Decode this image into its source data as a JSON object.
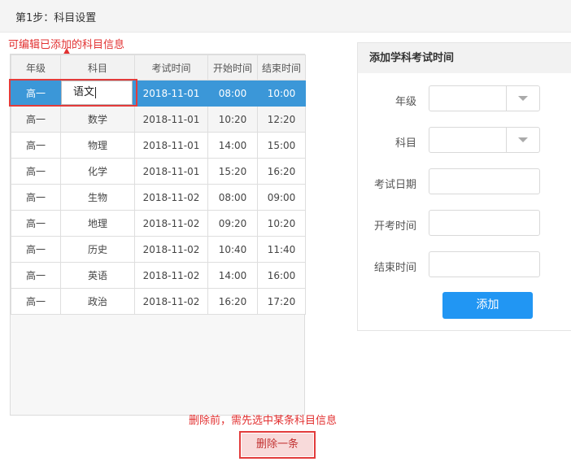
{
  "header": {
    "title": "第1步：科目设置"
  },
  "annotations": {
    "edit_hint": "可编辑已添加的科目信息",
    "delete_hint": "删除前，需先选中某条科目信息"
  },
  "table": {
    "columns": [
      "年级",
      "科目",
      "考试时间",
      "开始时间",
      "结束时间"
    ],
    "rows": [
      [
        "高一",
        "语文",
        "2018-11-01",
        "08:00",
        "10:00"
      ],
      [
        "高一",
        "数学",
        "2018-11-01",
        "10:20",
        "12:20"
      ],
      [
        "高一",
        "物理",
        "2018-11-01",
        "14:00",
        "15:00"
      ],
      [
        "高一",
        "化学",
        "2018-11-01",
        "15:20",
        "16:20"
      ],
      [
        "高一",
        "生物",
        "2018-11-02",
        "08:00",
        "09:00"
      ],
      [
        "高一",
        "地理",
        "2018-11-02",
        "09:20",
        "10:20"
      ],
      [
        "高一",
        "历史",
        "2018-11-02",
        "10:40",
        "11:40"
      ],
      [
        "高一",
        "英语",
        "2018-11-02",
        "14:00",
        "16:00"
      ],
      [
        "高一",
        "政治",
        "2018-11-02",
        "16:20",
        "17:20"
      ]
    ],
    "selected_row": 0,
    "editing_value": "语文"
  },
  "form": {
    "title": "添加学科考试时间",
    "fields": [
      {
        "label": "年级",
        "type": "select",
        "value": ""
      },
      {
        "label": "科目",
        "type": "select",
        "value": ""
      },
      {
        "label": "考试日期",
        "type": "input",
        "value": ""
      },
      {
        "label": "开考时间",
        "type": "input",
        "value": ""
      },
      {
        "label": "结束时间",
        "type": "input",
        "value": ""
      }
    ],
    "add_label": "添加"
  },
  "actions": {
    "delete_label": "删除一条"
  },
  "colors": {
    "selected_row": "#3b97d8",
    "annotation": "#e23131",
    "primary_button": "#2196f3"
  }
}
